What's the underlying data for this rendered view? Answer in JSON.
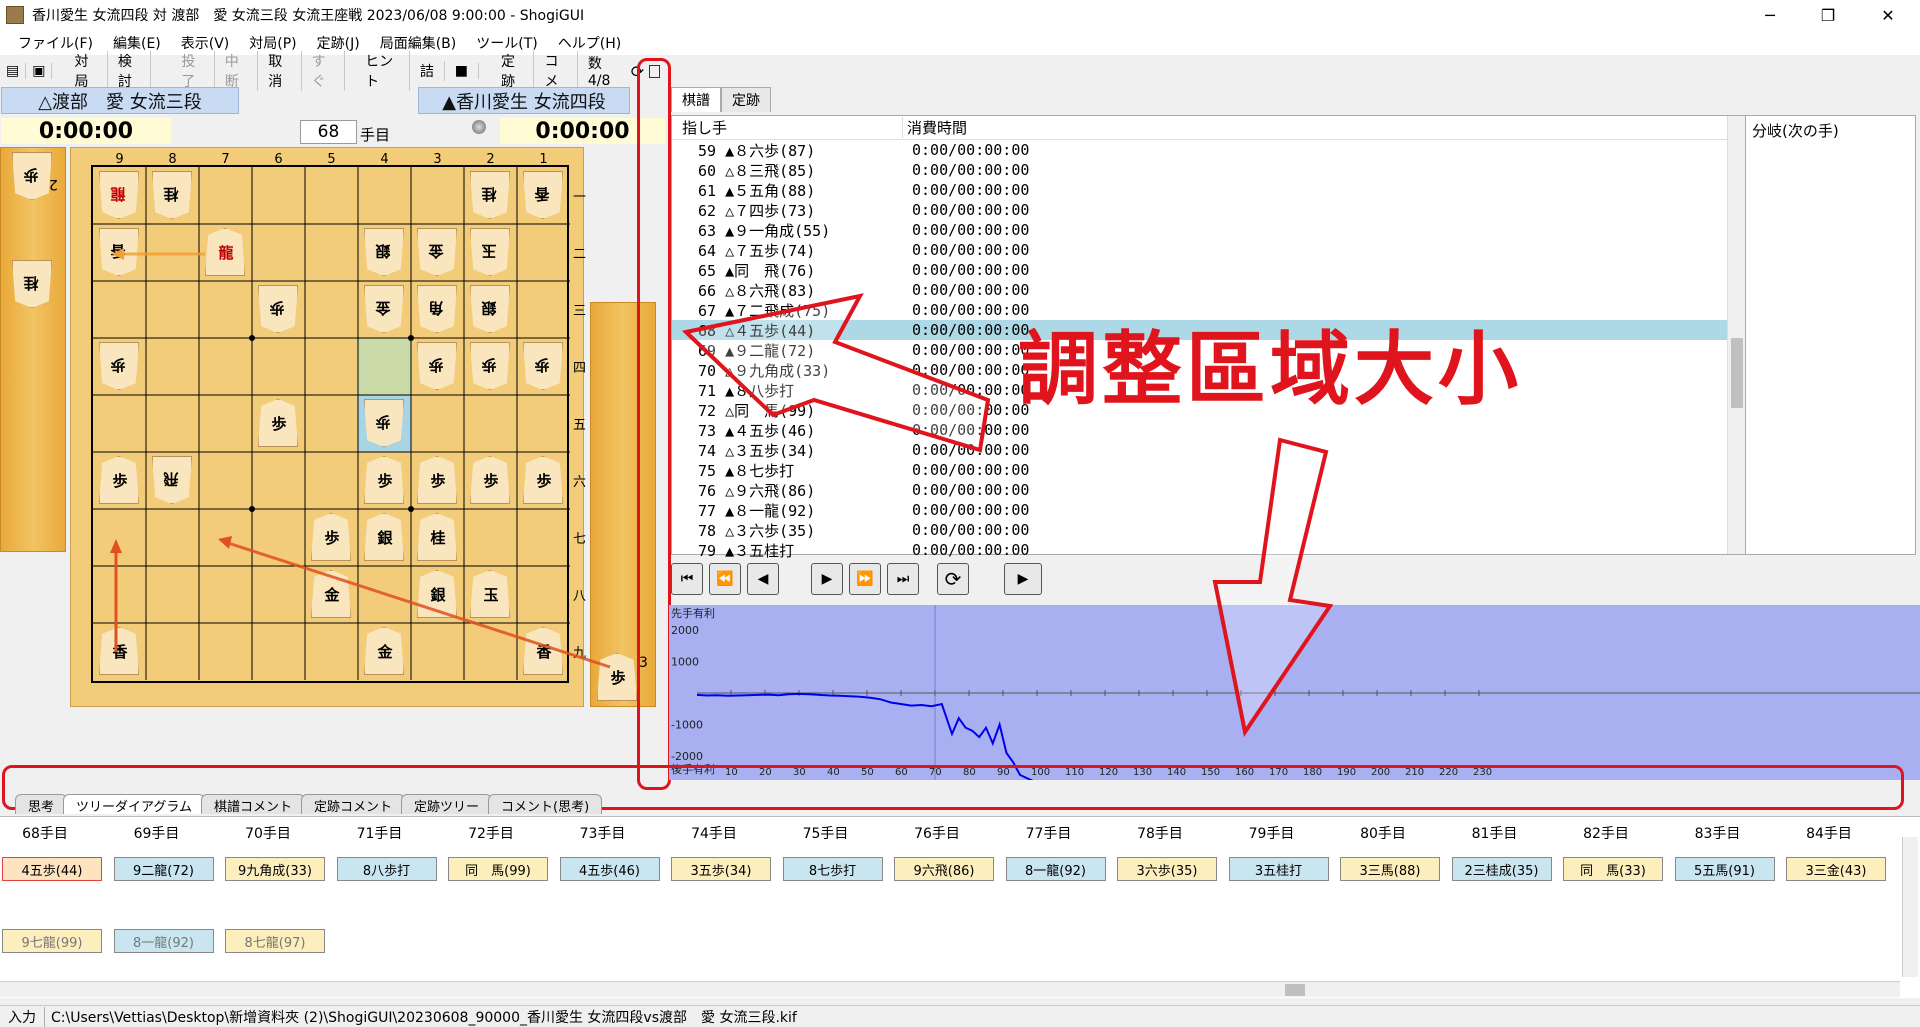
{
  "window": {
    "title": "香川愛生 女流四段 対 渡部　愛 女流三段 女流王座戦 2023/06/08 9:00:00 - ShogiGUI",
    "min": "─",
    "max": "❐",
    "close": "✕"
  },
  "menu": [
    "ファイル(F)",
    "編集(E)",
    "表示(V)",
    "対局(P)",
    "定跡(J)",
    "局面編集(B)",
    "ツール(T)",
    "ヘルプ(H)"
  ],
  "toolbar": [
    "対局",
    "検討",
    "投了",
    "中断",
    "取消",
    "すぐ",
    "ヒント",
    "詰",
    "■",
    "定跡",
    "コメ",
    "数 4/8"
  ],
  "players": {
    "gote_name": "△渡部　愛 女流三段",
    "sente_name": "▲香川愛生 女流四段",
    "gote_time": "0:00:00",
    "sente_time": "0:00:00",
    "move_no": "68",
    "move_suffix": "手目"
  },
  "board": {
    "files": [
      "9",
      "8",
      "7",
      "6",
      "5",
      "4",
      "3",
      "2",
      "1"
    ],
    "ranks": [
      "一",
      "二",
      "三",
      "四",
      "五",
      "六",
      "七",
      "八",
      "九"
    ],
    "pieces": [
      {
        "f": 9,
        "r": 1,
        "p": "龍",
        "gote": true,
        "red": true
      },
      {
        "f": 8,
        "r": 1,
        "p": "桂",
        "gote": true
      },
      {
        "f": 2,
        "r": 1,
        "p": "桂",
        "gote": true
      },
      {
        "f": 1,
        "r": 1,
        "p": "香",
        "gote": true
      },
      {
        "f": 9,
        "r": 2,
        "p": "香",
        "gote": true
      },
      {
        "f": 7,
        "r": 2,
        "p": "龍",
        "red": true
      },
      {
        "f": 4,
        "r": 2,
        "p": "銀",
        "gote": true
      },
      {
        "f": 3,
        "r": 2,
        "p": "金",
        "gote": true
      },
      {
        "f": 2,
        "r": 2,
        "p": "玉",
        "gote": true
      },
      {
        "f": 6,
        "r": 3,
        "p": "歩",
        "gote": true
      },
      {
        "f": 4,
        "r": 3,
        "p": "金",
        "gote": true
      },
      {
        "f": 3,
        "r": 3,
        "p": "角",
        "gote": true
      },
      {
        "f": 2,
        "r": 3,
        "p": "銀",
        "gote": true
      },
      {
        "f": 9,
        "r": 4,
        "p": "歩",
        "gote": true
      },
      {
        "f": 3,
        "r": 4,
        "p": "歩",
        "gote": true
      },
      {
        "f": 2,
        "r": 4,
        "p": "歩",
        "gote": true
      },
      {
        "f": 1,
        "r": 4,
        "p": "歩",
        "gote": true
      },
      {
        "f": 6,
        "r": 5,
        "p": "歩"
      },
      {
        "f": 4,
        "r": 5,
        "p": "歩",
        "gote": true
      },
      {
        "f": 9,
        "r": 6,
        "p": "歩"
      },
      {
        "f": 8,
        "r": 6,
        "p": "飛",
        "gote": true
      },
      {
        "f": 4,
        "r": 6,
        "p": "歩"
      },
      {
        "f": 3,
        "r": 6,
        "p": "歩"
      },
      {
        "f": 2,
        "r": 6,
        "p": "歩"
      },
      {
        "f": 1,
        "r": 6,
        "p": "歩"
      },
      {
        "f": 5,
        "r": 7,
        "p": "歩"
      },
      {
        "f": 4,
        "r": 7,
        "p": "銀"
      },
      {
        "f": 3,
        "r": 7,
        "p": "桂"
      },
      {
        "f": 5,
        "r": 8,
        "p": "金"
      },
      {
        "f": 3,
        "r": 8,
        "p": "銀"
      },
      {
        "f": 2,
        "r": 8,
        "p": "玉"
      },
      {
        "f": 9,
        "r": 9,
        "p": "香"
      },
      {
        "f": 4,
        "r": 9,
        "p": "金"
      },
      {
        "f": 1,
        "r": 9,
        "p": "香"
      }
    ],
    "gote_hand": [
      {
        "p": "歩",
        "n": "2"
      },
      {
        "p": "桂",
        "n": ""
      }
    ],
    "sente_hand": [
      {
        "p": "歩",
        "n": "3"
      }
    ]
  },
  "kifu": {
    "tab_moves": "棋譜",
    "tab_joseki": "定跡",
    "col_move": "指し手",
    "col_time": "消費時間",
    "branch_header": "分岐(次の手)",
    "rows": [
      [
        "59",
        "▲８六歩(87)",
        "0:00/00:00:00"
      ],
      [
        "60",
        "△８三飛(85)",
        "0:00/00:00:00"
      ],
      [
        "61",
        "▲５五角(88)",
        "0:00/00:00:00"
      ],
      [
        "62",
        "△７四歩(73)",
        "0:00/00:00:00"
      ],
      [
        "63",
        "▲９一角成(55)",
        "0:00/00:00:00"
      ],
      [
        "64",
        "△７五歩(74)",
        "0:00/00:00:00"
      ],
      [
        "65",
        "▲同　飛(76)",
        "0:00/00:00:00"
      ],
      [
        "66",
        "△８六飛(83)",
        "0:00/00:00:00"
      ],
      [
        "67",
        "▲７二飛成(75)",
        "0:00/00:00:00"
      ],
      [
        "68",
        "△４五歩(44)",
        "0:00/00:00:00"
      ],
      [
        "69",
        "▲９二龍(72)",
        "0:00/00:00:00"
      ],
      [
        "70",
        "△９九角成(33)",
        "0:00/00:00:00"
      ],
      [
        "71",
        "▲８八歩打",
        "0:00/00:00:00"
      ],
      [
        "72",
        "△同　馬(99)",
        "0:00/00:00:00"
      ],
      [
        "73",
        "▲４五歩(46)",
        "0:00/00:00:00"
      ],
      [
        "74",
        "△３五歩(34)",
        "0:00/00:00:00"
      ],
      [
        "75",
        "▲８七歩打",
        "0:00/00:00:00"
      ],
      [
        "76",
        "△９六飛(86)",
        "0:00/00:00:00"
      ],
      [
        "77",
        "▲８一龍(92)",
        "0:00/00:00:00"
      ],
      [
        "78",
        "△３六歩(35)",
        "0:00/00:00:00"
      ],
      [
        "79",
        "▲３五桂打",
        "0:00/00:00:00"
      ]
    ],
    "selected": "68"
  },
  "graph": {
    "top_label": "先手有利",
    "bottom_label": "後手有利",
    "yticks": [
      "2000",
      "1000",
      "-1000",
      "-2000"
    ],
    "xticks": [
      "10",
      "20",
      "30",
      "40",
      "50",
      "60",
      "70",
      "80",
      "90",
      "100",
      "110",
      "120",
      "130",
      "140",
      "150",
      "160",
      "170",
      "180",
      "190",
      "200",
      "210",
      "220",
      "230"
    ],
    "values": [
      -60,
      -80,
      -70,
      -90,
      -80,
      -70,
      -60,
      -50,
      -70,
      -40,
      -30,
      -40,
      -60,
      -80,
      -90,
      -100,
      -120,
      -150,
      -200,
      -300,
      -350,
      -400,
      -380,
      -420,
      -350,
      -1300,
      -800,
      -1100,
      -1200,
      -1400,
      -1100,
      -1600,
      -1000,
      -1900,
      -2200,
      -2600,
      -2700,
      -2800,
      -2850
    ]
  },
  "bottom_tabs": [
    "思考",
    "ツリーダイアグラム",
    "棋譜コメント",
    "定跡コメント",
    "定跡ツリー",
    "コメント(思考)"
  ],
  "tree": {
    "cols": [
      "68手目",
      "69手目",
      "70手目",
      "71手目",
      "72手目",
      "73手目",
      "74手目",
      "75手目",
      "76手目",
      "77手目",
      "78手目",
      "79手目",
      "80手目",
      "81手目",
      "82手目",
      "83手目",
      "84手目"
    ],
    "main": [
      "4五歩(44)",
      "9二龍(72)",
      "9九角成(33)",
      "8八歩打",
      "同　馬(99)",
      "4五歩(46)",
      "3五歩(34)",
      "8七歩打",
      "9六飛(86)",
      "8一龍(92)",
      "3六歩(35)",
      "3五桂打",
      "3三馬(88)",
      "2三桂成(35)",
      "同　馬(33)",
      "5五馬(91)",
      "3三金(43)"
    ],
    "alt": [
      "9七龍(99)",
      "8一龍(92)",
      "8七龍(97)"
    ]
  },
  "status": {
    "mode": "入力",
    "path": "C:\\Users\\Vettias\\Desktop\\新增資料夾 (2)\\ShogiGUI\\20230608_90000_香川愛生 女流四段vs渡部　愛 女流三段.kif"
  },
  "annotation": {
    "text": "調整區域大小"
  },
  "colors": {
    "annot": "#e0141c",
    "graph_bg": "#a9b0f2",
    "sel": "#add8e6"
  }
}
